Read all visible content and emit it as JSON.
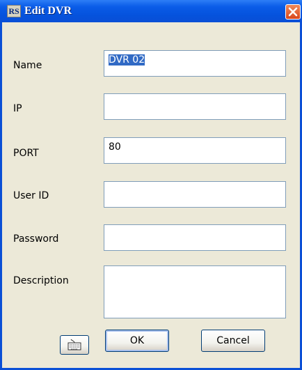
{
  "window": {
    "title": "Edit DVR",
    "app_icon_text": "RS"
  },
  "form": {
    "name_label": "Name",
    "name_value": "DVR 02",
    "ip_label": "IP",
    "ip_value": "",
    "port_label": "PORT",
    "port_value": "80",
    "userid_label": "User ID",
    "userid_value": "",
    "password_label": "Password",
    "password_value": "",
    "description_label": "Description",
    "description_value": ""
  },
  "buttons": {
    "ok": "OK",
    "cancel": "Cancel",
    "keyboard_icon": "keyboard-icon"
  },
  "colors": {
    "titlebar": "#0a5ce8",
    "dialog_bg": "#ece9d8",
    "close": "#d8461c",
    "selection": "#316ac5"
  }
}
